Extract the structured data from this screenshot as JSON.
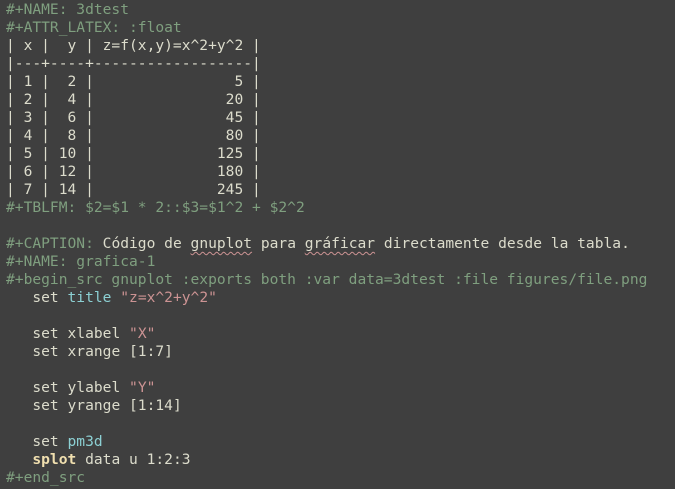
{
  "header": {
    "name_line": "#+NAME: 3dtest",
    "attr_line": "#+ATTR_LATEX: :float"
  },
  "table": {
    "header_row": "| x |  y | z=f(x,y)=x^2+y^2 |",
    "separator": "|---+----+------------------|",
    "rows": [
      "| 1 |  2 |                5 |",
      "| 2 |  4 |               20 |",
      "| 3 |  6 |               45 |",
      "| 4 |  8 |               80 |",
      "| 5 | 10 |              125 |",
      "| 6 | 12 |              180 |",
      "| 7 | 14 |              245 |"
    ],
    "formula_line": "#+TBLFM: $2=$1 * 2::$3=$1^2 + $2^2"
  },
  "caption": {
    "keyword": "#+CAPTION:",
    "w1": " Código de ",
    "w2": "gnuplot",
    "w3": " para ",
    "w4": "gráficar",
    "w5": " directamente desde la tabla."
  },
  "block": {
    "name_line": "#+NAME: grafica-1",
    "begin_line": "#+begin_src gnuplot :exports both :var data=3dtest :file figures/file.png",
    "end_line": "#+end_src"
  },
  "code": {
    "l1_set": "set",
    "l1_cmd": "title",
    "l1_str": "\"z=x^2+y^2\"",
    "l2_set": "set",
    "l2_rest": "xlabel",
    "l2_str": "\"X\"",
    "l3_set": "set",
    "l3_rest": "xrange [1:7]",
    "l4_set": "set",
    "l4_rest": "ylabel",
    "l4_str": "\"Y\"",
    "l5_set": "set",
    "l5_rest": "yrange [1:14]",
    "l6_set": "set",
    "l6_cmd": "pm3d",
    "l7_kw": "splot",
    "l7_rest": "data u 1:2:3"
  },
  "colors": {
    "background": "#3f3f3f",
    "meta": "#7f9f7f",
    "text": "#dcdccc",
    "keyword": "#f0dfaf",
    "builtin": "#8cd0d3",
    "string": "#cc9393"
  }
}
